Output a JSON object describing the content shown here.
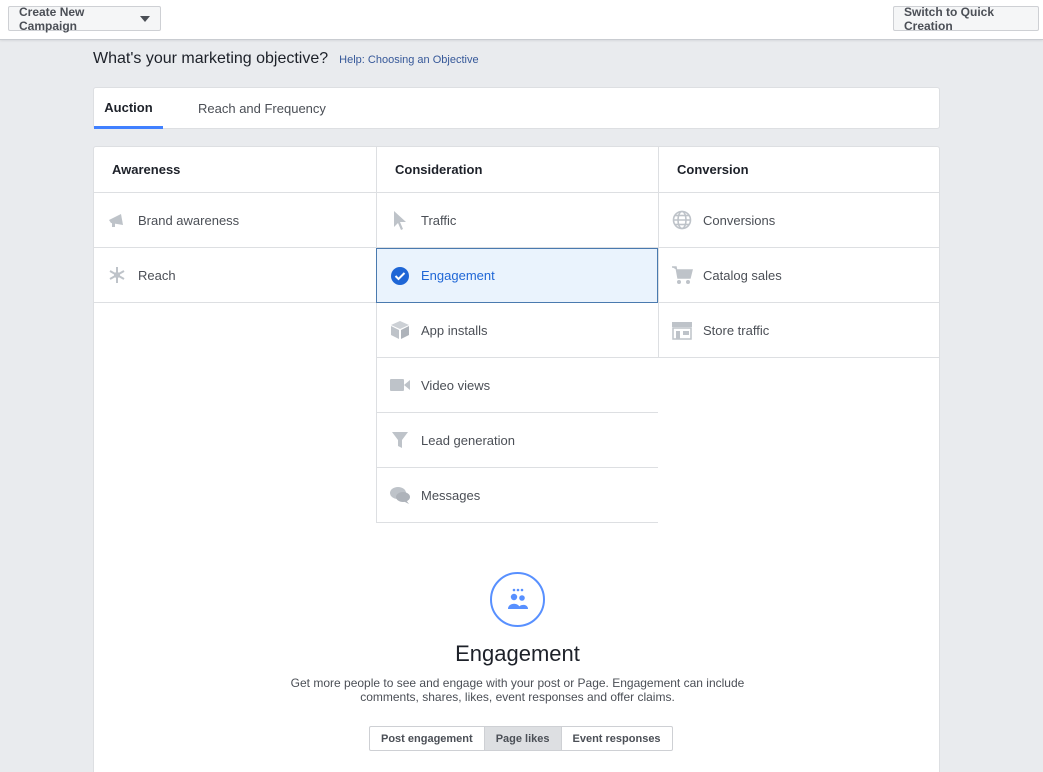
{
  "topbar": {
    "create_label": "Create New Campaign",
    "switch_label": "Switch to Quick Creation"
  },
  "heading": {
    "question": "What's your marketing objective?",
    "help_link": "Help: Choosing an Objective"
  },
  "tabs": [
    {
      "label": "Auction",
      "active": true
    },
    {
      "label": "Reach and Frequency",
      "active": false
    }
  ],
  "columns": {
    "awareness": {
      "title": "Awareness",
      "items": [
        {
          "label": "Brand awareness",
          "icon": "megaphone-icon"
        },
        {
          "label": "Reach",
          "icon": "reach-icon"
        }
      ]
    },
    "consideration": {
      "title": "Consideration",
      "items": [
        {
          "label": "Traffic",
          "icon": "cursor-icon"
        },
        {
          "label": "Engagement",
          "icon": "check-circle-icon",
          "selected": true
        },
        {
          "label": "App installs",
          "icon": "box-icon"
        },
        {
          "label": "Video views",
          "icon": "video-camera-icon"
        },
        {
          "label": "Lead generation",
          "icon": "funnel-icon"
        },
        {
          "label": "Messages",
          "icon": "chat-bubbles-icon"
        }
      ]
    },
    "conversion": {
      "title": "Conversion",
      "items": [
        {
          "label": "Conversions",
          "icon": "globe-icon"
        },
        {
          "label": "Catalog sales",
          "icon": "cart-icon"
        },
        {
          "label": "Store traffic",
          "icon": "store-icon"
        }
      ]
    }
  },
  "detail": {
    "icon": "people-icon",
    "title": "Engagement",
    "description": "Get more people to see and engage with your post or Page. Engagement can include comments, shares, likes, event responses and offer claims.",
    "subtabs": [
      {
        "label": "Post engagement",
        "active": false
      },
      {
        "label": "Page likes",
        "active": true
      },
      {
        "label": "Event responses",
        "active": false
      }
    ]
  },
  "colors": {
    "accent": "#4080ff",
    "selected_bg": "#eaf3fd",
    "selected_text": "#1f66d6",
    "icon_gray": "#bec3c9"
  }
}
